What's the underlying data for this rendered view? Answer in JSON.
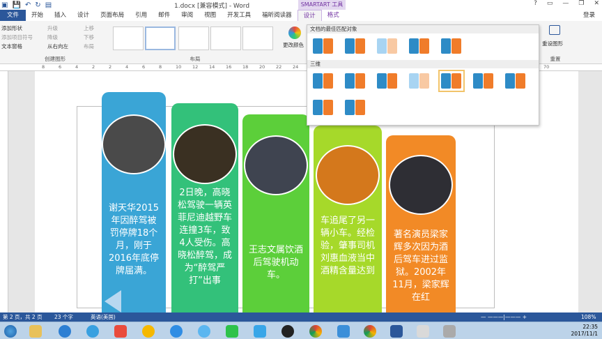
{
  "window": {
    "title": "1.docx [兼容模式] - Word",
    "context_title": "SMARTART 工具",
    "login": "登录",
    "win_buttons": [
      "?",
      "▭",
      "—",
      "❐",
      "✕"
    ]
  },
  "tabs": [
    "文件",
    "开始",
    "插入",
    "设计",
    "页面布局",
    "引用",
    "邮件",
    "审阅",
    "视图",
    "开发工具",
    "福昕阅读器",
    "设计",
    "格式"
  ],
  "ribbon": {
    "create_group": {
      "label": "创建图形",
      "buttons": [
        "添加形状",
        "添加项目符号",
        "文本窗格",
        "升级",
        "降级",
        "从右向左",
        "上移",
        "下移",
        "布局"
      ]
    },
    "layout_group": {
      "label": "布局"
    },
    "change_colors": "更改颜色",
    "reset_group": {
      "label": "重置",
      "reset_graphic": "重设图形"
    }
  },
  "ruler": {
    "ticks": [
      "8",
      "6",
      "4",
      "2",
      "2",
      "4",
      "6",
      "8",
      "10",
      "12",
      "14",
      "16",
      "18",
      "20",
      "22",
      "24",
      "26",
      "28",
      "30",
      "32",
      "34",
      "36",
      "38",
      "40",
      "42",
      "44",
      "46",
      "48",
      "50",
      "52",
      "70"
    ]
  },
  "gallery": {
    "section1": "文档的最佳匹配对象",
    "section2": "三维"
  },
  "cards": [
    {
      "color": "#3aa5d6",
      "text": "谢天华2015年因醉驾被罚停牌18个月，刚于2016年底停牌届满。"
    },
    {
      "color": "#33c17a",
      "text": "2日晚，高晓松驾驶一辆英菲尼迪越野车连撞3车，致4人受伤。高晓松醉驾，成为“醉驾严打”出事"
    },
    {
      "color": "#5ccf3a",
      "text": "王志文属饮酒后驾驶机动车。"
    },
    {
      "color": "#a6d92a",
      "text": "车追尾了另一辆小车。经检验，肇事司机刘惠血液当中酒精含量达到"
    },
    {
      "color": "#f28a26",
      "text": "著名演员梁家辉多次因为酒后驾车进过监狱。2002年11月，梁家辉在红"
    }
  ],
  "status": {
    "page": "第 2 页，共 2 页",
    "words": "23 个字",
    "lang": "英语(美国)",
    "zoom": "108%"
  },
  "clock": {
    "time": "22:35",
    "date": "2017/11/1"
  }
}
